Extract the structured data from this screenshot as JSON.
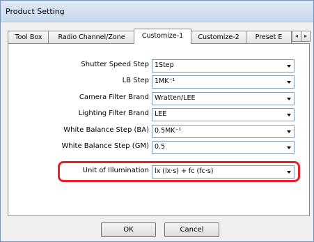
{
  "window": {
    "title": "Product Setting"
  },
  "tabs": [
    {
      "label": "Tool Box"
    },
    {
      "label": "Radio Channel/Zone"
    },
    {
      "label": "Customize-1"
    },
    {
      "label": "Customize-2"
    },
    {
      "label": "Preset E"
    }
  ],
  "tab_scroll": {
    "left": "◂",
    "right": "▸"
  },
  "settings": [
    {
      "label": "Shutter Speed Step",
      "value": "1Step"
    },
    {
      "label": "LB Step",
      "value": "1MK⁻¹"
    },
    {
      "label": "Camera Filter Brand",
      "value": "Wratten/LEE"
    },
    {
      "label": "Lighting Filter Brand",
      "value": "LEE"
    },
    {
      "label": "White Balance Step (BA)",
      "value": "0.5MK⁻¹"
    },
    {
      "label": "White Balance Step (GM)",
      "value": "0.5"
    },
    {
      "label": "Unit of Illumination",
      "value": "lx (lx·s) + fc (fc·s)"
    }
  ],
  "buttons": {
    "ok": "OK",
    "cancel": "Cancel"
  },
  "colors": {
    "highlight": "#e8202a"
  }
}
